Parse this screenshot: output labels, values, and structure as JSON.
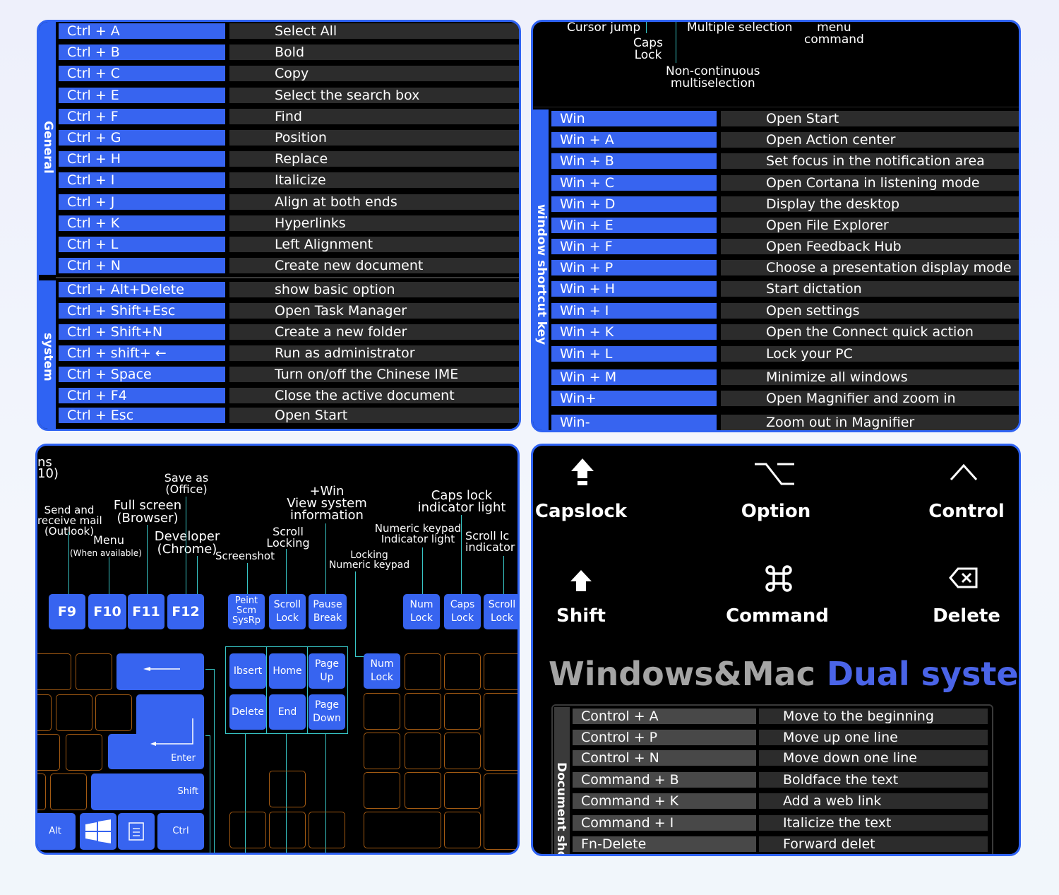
{
  "panel1": {
    "general_label": "General",
    "system_label": "system",
    "general_rows": [
      {
        "key": "Ctrl + A",
        "desc": "Select All"
      },
      {
        "key": "Ctrl + B",
        "desc": "Bold"
      },
      {
        "key": "Ctrl + C",
        "desc": "Copy"
      },
      {
        "key": "Ctrl + E",
        "desc": "Select the search box"
      },
      {
        "key": "Ctrl + F",
        "desc": "Find"
      },
      {
        "key": "Ctrl + G",
        "desc": "Position"
      },
      {
        "key": "Ctrl + H",
        "desc": "Replace"
      },
      {
        "key": "Ctrl + I",
        "desc": "Italicize"
      },
      {
        "key": "Ctrl + J",
        "desc": "Align at both ends"
      },
      {
        "key": "Ctrl + K",
        "desc": "Hyperlinks"
      },
      {
        "key": "Ctrl + L",
        "desc": "Left Alignment"
      },
      {
        "key": "Ctrl + N",
        "desc": "Create new document"
      }
    ],
    "system_rows": [
      {
        "key": "Ctrl + Alt+Delete",
        "desc": "show basic option"
      },
      {
        "key": "Ctrl + Shift+Esc",
        "desc": "Open Task Manager"
      },
      {
        "key": "Ctrl + Shift+N",
        "desc": "Create a new folder"
      },
      {
        "key": "Ctrl + shift+ ←",
        "desc": "Run as administrator"
      },
      {
        "key": "Ctrl + Space",
        "desc": "Turn on/off the Chinese IME"
      },
      {
        "key": "Ctrl + F4",
        "desc": "Close the active document"
      },
      {
        "key": "Ctrl + Esc",
        "desc": "Open Start"
      }
    ]
  },
  "panel2": {
    "top_labels": {
      "cursor_jump": "Cursor jump",
      "caps_lock": "Caps\nLock",
      "multiple_selection": "Multiple selection",
      "menu_command": "menu\ncommand",
      "non_continuous": "Non-continuous\nmultiselection"
    },
    "side_label": "window shortcut key",
    "rows": [
      {
        "key": "Win",
        "desc": "Open Start"
      },
      {
        "key": "Win + A",
        "desc": "Open Action center"
      },
      {
        "key": "Win + B",
        "desc": "Set focus in the notification area"
      },
      {
        "key": "Win + C",
        "desc": "Open Cortana in listening mode"
      },
      {
        "key": "Win + D",
        "desc": "Display the desktop"
      },
      {
        "key": "Win + E",
        "desc": "Open File Explorer"
      },
      {
        "key": "Win + F",
        "desc": "Open Feedback Hub"
      },
      {
        "key": "Win + P",
        "desc": "Choose a presentation display mode"
      },
      {
        "key": "Win + H",
        "desc": "Start dictation"
      },
      {
        "key": "Win + I",
        "desc": "Open settings"
      },
      {
        "key": "Win + K",
        "desc": "Open the Connect quick action"
      },
      {
        "key": "Win + L",
        "desc": "Lock your PC"
      },
      {
        "key": "Win + M",
        "desc": "Minimize all windows"
      },
      {
        "key": "Win+",
        "desc": "Open Magnifier and zoom in"
      },
      {
        "key": "Win-",
        "desc": "Zoom out in Magnifier"
      }
    ]
  },
  "panel3": {
    "labels": {
      "cut_top": "ns\n10)",
      "save_as": "Save as\n(Office)",
      "send_receive": "Send and\nreceive mail\n(Outlook)",
      "full_screen": "Full screen\n(Browser)",
      "menu": "Menu",
      "when_available": "(When available)",
      "developer": "Developer\n(Chrome)",
      "screenshot": "Screenshot",
      "win_view": "+Win\nView system\ninformation",
      "scroll_locking": "Scroll\nLocking",
      "caps_indicator": "Caps lock\nindicator light",
      "numeric_indicator": "Numeric keypad\nIndicator light",
      "scroll_indicator": "Scroll lc\nindicator",
      "locking_numeric": "Locking\nNumeric keypad"
    },
    "keys": {
      "f9": "F9",
      "f10": "F10",
      "f11": "F11",
      "f12": "F12",
      "print": "Peint\nScm\nSysRp",
      "scroll": "Scroll\nLock",
      "pause": "Pause\nBreak",
      "numlock_top": "Num\nLock",
      "capslock": "Caps\nLock",
      "scrolllock": "Scroll\nLock",
      "insert": "Ibsert",
      "home": "Home",
      "pageup": "Page\nUp",
      "delete": "Delete",
      "end": "End",
      "pagedown": "Page\nDown",
      "numlock": "Num\nLock",
      "enter": "Enter",
      "shift": "Shift",
      "alt": "Alt",
      "ctrl": "Ctrl"
    }
  },
  "panel4": {
    "icons": [
      {
        "name": "capslock-icon",
        "label": "Capslock"
      },
      {
        "name": "option-icon",
        "label": "Option"
      },
      {
        "name": "control-icon",
        "label": "Control"
      },
      {
        "name": "shift-icon",
        "label": "Shift"
      },
      {
        "name": "command-icon",
        "label": "Command"
      },
      {
        "name": "delete-icon",
        "label": "Delete"
      }
    ],
    "title_part1": "Windows&Mac",
    "title_part2": "Dual system",
    "side_label": "Document sho",
    "rows": [
      {
        "key": "Control + A",
        "desc": "Move to the beginning"
      },
      {
        "key": "Control + P",
        "desc": "Move up one line"
      },
      {
        "key": "Control + N",
        "desc": "Move down one line"
      },
      {
        "key": "Command + B",
        "desc": "Boldface the text"
      },
      {
        "key": "Command + K",
        "desc": "Add a web link"
      },
      {
        "key": "Command + I",
        "desc": "Italicize the text"
      },
      {
        "key": "Fn-Delete",
        "desc": "Forward delet"
      }
    ],
    "colors": {
      "accent": "#2f63f3",
      "title_grey": "#a4a4a4",
      "title_blue": "#4a64e8"
    }
  }
}
